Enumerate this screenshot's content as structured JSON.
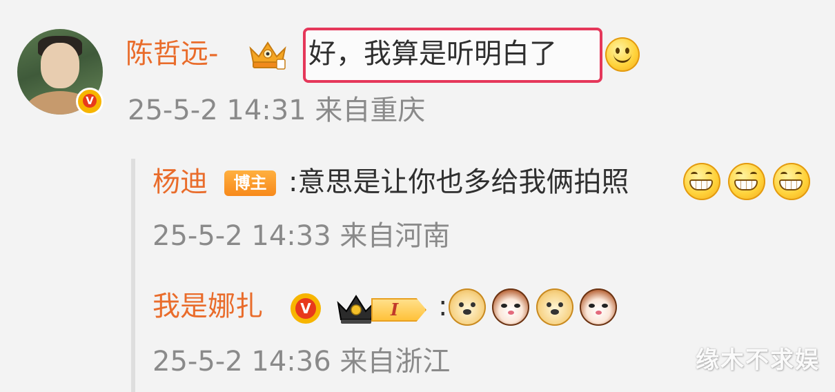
{
  "main_comment": {
    "username": "陈哲远-",
    "text": "好，我算是听明白了",
    "meta": "25-5-2 14:31 来自重庆",
    "avatar_badge": "V"
  },
  "replies": [
    {
      "username": "杨迪",
      "badge": "博主",
      "text": ":意思是让你也多给我俩拍照",
      "meta": "25-5-2 14:33 来自河南"
    },
    {
      "username": "我是娜扎",
      "verified_badge": "V",
      "level_badge": "I",
      "text": ":",
      "meta": "25-5-2 14:36 来自浙江"
    }
  ],
  "watermark": "缘木不求娱",
  "icons": {
    "avatar_verified": "verified-icon",
    "crown_badge": "crown-icon",
    "smile": "smile-emoji-icon",
    "grin": "grin-emoji-icon",
    "dog": "dog-emoji-icon",
    "cat": "cat-emoji-icon"
  },
  "colors": {
    "username": "#e96c2b",
    "highlight_border": "#e5375a",
    "meta_text": "#8a8a8a",
    "badge_orange": "#f7891b",
    "verified_red": "#e8391c"
  }
}
